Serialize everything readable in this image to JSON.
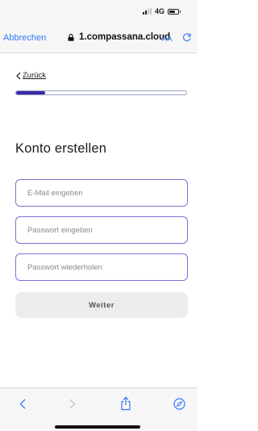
{
  "status_bar": {
    "network": "4G",
    "signal_bars": 4,
    "signal_active": 2,
    "battery_level": 0.65
  },
  "browser": {
    "cancel_label": "Abbrechen",
    "url": "1.compassana.cloud",
    "text_size_label": "AA"
  },
  "page": {
    "back_label": "Zurück",
    "progress": 0.17,
    "title": "Konto erstellen",
    "fields": {
      "email_placeholder": "E-Mail eingeben",
      "password_placeholder": "Passwort eingeben",
      "password_repeat_placeholder": "Passwort wiederholen"
    },
    "submit_label": "Weiter"
  },
  "toolbar": {
    "icons": [
      "chevron-left-icon",
      "chevron-right-icon",
      "share-icon",
      "compass-icon"
    ]
  },
  "colors": {
    "accent": "#3b2aa8",
    "field_border": "#7d6fd6",
    "link": "#3478f6",
    "button_bg": "#ececec"
  }
}
